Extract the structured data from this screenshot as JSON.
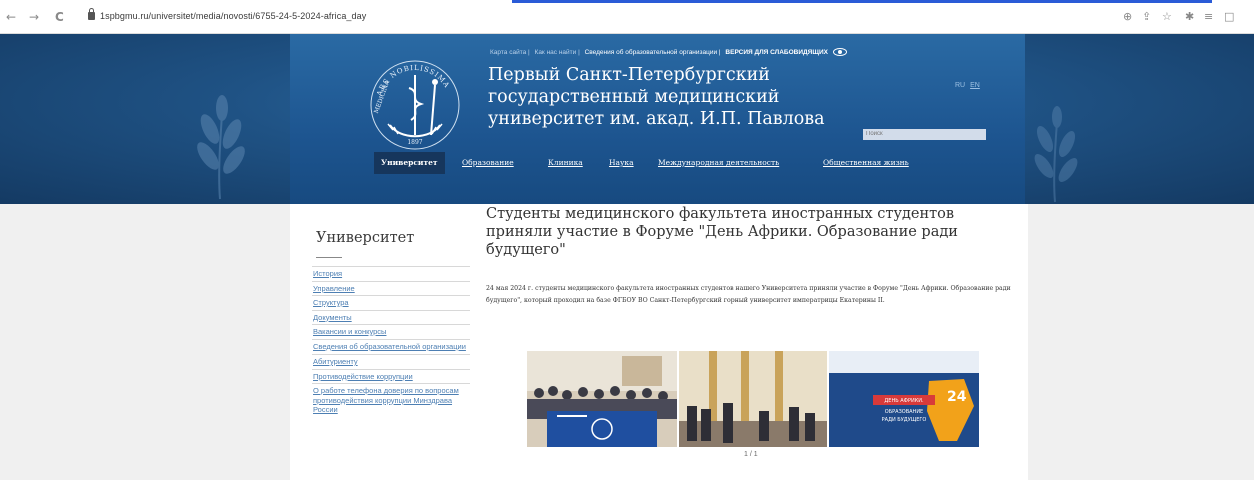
{
  "browser": {
    "back_icon": "←",
    "forward_icon": "→",
    "reload_icon": "C",
    "url": "1spbgmu.ru/universitet/media/novosti/6755-24-5-2024-africa_day",
    "toolbar_icons": [
      "zoom-icon",
      "share-icon",
      "star-icon",
      "extension-icon",
      "playlist-icon",
      "window-icon"
    ]
  },
  "header": {
    "top_links": [
      "Карта сайта |",
      "Как нас найти |",
      "Сведения об образовательной организации |"
    ],
    "vision_label": "ВЕРСИЯ ДЛЯ СЛАБОВИДЯЩИХ",
    "title_line1": "Первый Санкт-Петербургский",
    "title_line2": "государственный медицинский",
    "title_line3": "университет им. акад. И.П. Павлова",
    "lang_ru": "RU",
    "lang_en": "EN",
    "search_placeholder": "Поиск",
    "logo_motto": "ARS NOBILISSIMA",
    "logo_motto_left": "MEDICINA",
    "logo_year": "1897",
    "nav": [
      "Университет",
      "Образование",
      "Клиника",
      "Наука",
      "Международная деятельность",
      "Общественная жизнь"
    ]
  },
  "sidebar": {
    "title": "Университет",
    "items": [
      "История",
      "Управление",
      "Структура",
      "Документы",
      "Вакансии и конкурсы",
      "Сведения об образовательной организации",
      "Абитуриенту",
      "Противодействие коррупции",
      "О работе телефона доверия по вопросам противодействия коррупции Минздрава России"
    ]
  },
  "article": {
    "title": "Студенты медицинского факультета иностранных студентов приняли участие в Форуме \"День Африки. Образование ради будущего\"",
    "body": "24 мая 2024 г. студенты медицинского факультета иностранных студентов нашего Университета приняли участие в Форуме \"День Африки. Образование ради будущего\", который проходил на базе ФГБОУ ВО Санкт-Петербургский горный университет императрицы Екатерины II.",
    "banner_lines": [
      "ДЕНЬ АФРИКИ.",
      "ОБРАЗОВАНИЕ",
      "РАДИ БУДУЩЕГО"
    ],
    "banner_date": "24",
    "counter": "1 / 1"
  },
  "colors": {
    "header_blue": "#1f5284",
    "nav_active": "#16365c",
    "link": "#4d7fb3",
    "side_bg": "#f0f0f0",
    "browser_accent": "#2a5bd7"
  }
}
